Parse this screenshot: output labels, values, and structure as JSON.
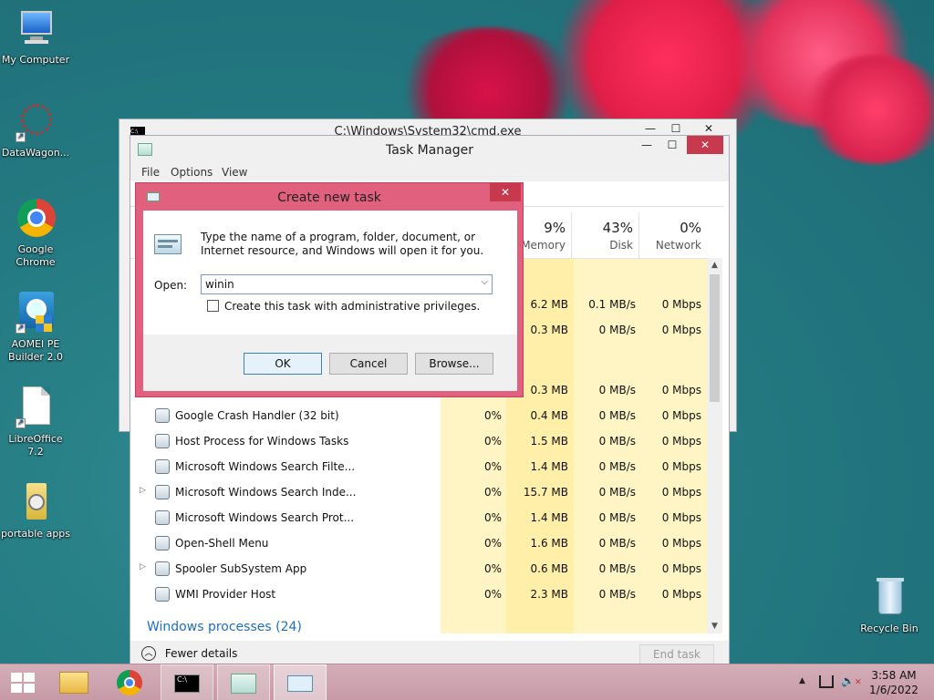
{
  "desktop": {
    "icons": [
      {
        "label": "My Computer"
      },
      {
        "label": "DataWagon..."
      },
      {
        "label": "Google Chrome"
      },
      {
        "label": "AOMEI PE Builder 2.0"
      },
      {
        "label": "LibreOffice 7.2"
      },
      {
        "label": "portable apps"
      },
      {
        "label": "Recycle Bin"
      }
    ]
  },
  "cmd": {
    "title": "C:\\Windows\\System32\\cmd.exe",
    "icon_text": "C:\\"
  },
  "taskmanager": {
    "title": "Task Manager",
    "menu": [
      "File",
      "Options",
      "View"
    ],
    "columns": [
      {
        "pct": "9%",
        "label": "Memory"
      },
      {
        "pct": "43%",
        "label": "Disk"
      },
      {
        "pct": "0%",
        "label": "Network"
      }
    ],
    "rows": [
      {
        "name": "",
        "cpu": "",
        "mem": "6.2 MB",
        "disk": "0.1 MB/s",
        "net": "0 Mbps"
      },
      {
        "name": "",
        "cpu": "",
        "mem": "0.3 MB",
        "disk": "0 MB/s",
        "net": "0 Mbps"
      },
      {
        "name": "",
        "cpu": "",
        "mem": "0.3 MB",
        "disk": "0 MB/s",
        "net": "0 Mbps"
      },
      {
        "name": "Google Crash Handler (32 bit)",
        "cpu": "0%",
        "mem": "0.4 MB",
        "disk": "0 MB/s",
        "net": "0 Mbps",
        "icon": "crash-handler-icon"
      },
      {
        "name": "Host Process for Windows Tasks",
        "cpu": "0%",
        "mem": "1.5 MB",
        "disk": "0 MB/s",
        "net": "0 Mbps",
        "icon": "host-process-icon"
      },
      {
        "name": "Microsoft Windows Search Filte...",
        "cpu": "0%",
        "mem": "1.4 MB",
        "disk": "0 MB/s",
        "net": "0 Mbps",
        "icon": "search-filter-icon"
      },
      {
        "name": "Microsoft Windows Search Inde...",
        "cpu": "0%",
        "mem": "15.7 MB",
        "disk": "0 MB/s",
        "net": "0 Mbps",
        "icon": "search-indexer-icon",
        "expandable": true
      },
      {
        "name": "Microsoft Windows Search Prot...",
        "cpu": "0%",
        "mem": "1.4 MB",
        "disk": "0 MB/s",
        "net": "0 Mbps",
        "icon": "search-protocol-icon"
      },
      {
        "name": "Open-Shell Menu",
        "cpu": "0%",
        "mem": "1.6 MB",
        "disk": "0 MB/s",
        "net": "0 Mbps",
        "icon": "open-shell-icon"
      },
      {
        "name": "Spooler SubSystem App",
        "cpu": "0%",
        "mem": "0.6 MB",
        "disk": "0 MB/s",
        "net": "0 Mbps",
        "icon": "printer-icon",
        "expandable": true
      },
      {
        "name": "WMI Provider Host",
        "cpu": "0%",
        "mem": "2.3 MB",
        "disk": "0 MB/s",
        "net": "0 Mbps",
        "icon": "wmi-icon"
      }
    ],
    "section": "Windows processes (24)",
    "fewer_details": "Fewer details",
    "end_task": "End task"
  },
  "dialog": {
    "title": "Create new task",
    "description": "Type the name of a program, folder, document, or Internet resource, and Windows will open it for you.",
    "open_label": "Open:",
    "open_value": "winin",
    "admin_label": "Create this task with administrative privileges.",
    "ok": "OK",
    "cancel": "Cancel",
    "browse": "Browse..."
  },
  "taskbar": {
    "time": "3:58 AM",
    "date": "1/6/2022",
    "cmd_icon_text": "C:\\"
  },
  "colors": {
    "dialog_border": "#e0607e",
    "close_red": "#c7394c",
    "heat_yellow": "#fff4c4",
    "heat_yellow2": "#ffefa8",
    "link_blue": "#1e6fbd",
    "taskbar_bg": "#c79aa6"
  }
}
